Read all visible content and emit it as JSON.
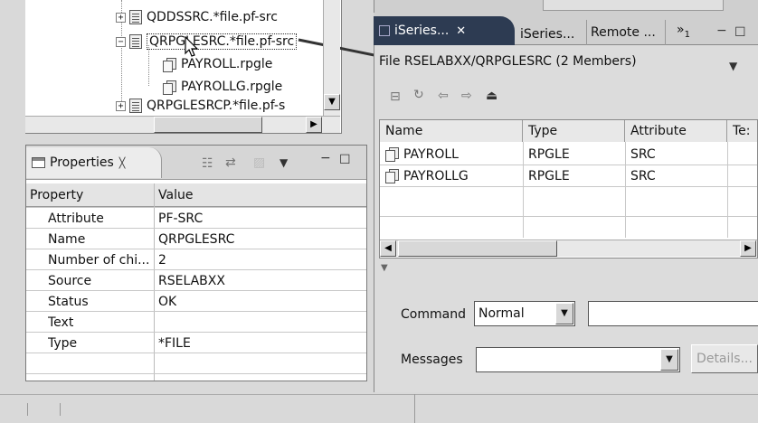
{
  "tree": {
    "items": [
      {
        "label": "QDDSSRC.*file.pf-src",
        "expander": "+"
      },
      {
        "label": "QRPGLESRC.*file.pf-src",
        "expander": "−"
      },
      {
        "label": "PAYROLL.rpgle"
      },
      {
        "label": "PAYROLLG.rpgle"
      },
      {
        "label": "QRPGLESRCP.*file.pf-s",
        "expander": "+"
      }
    ]
  },
  "properties": {
    "tab_title": "Properties",
    "tab_close": "╳",
    "headers": {
      "property": "Property",
      "value": "Value"
    },
    "rows": [
      {
        "property": "Attribute",
        "value": "PF-SRC"
      },
      {
        "property": "Name",
        "value": "QRPGLESRC"
      },
      {
        "property": "Number of chi...",
        "value": "2"
      },
      {
        "property": "Source",
        "value": "RSELABXX"
      },
      {
        "property": "Status",
        "value": "OK"
      },
      {
        "property": "Text",
        "value": ""
      },
      {
        "property": "Type",
        "value": "*FILE"
      }
    ]
  },
  "iseries": {
    "tabs": [
      {
        "label": "iSeries...",
        "close": "✕",
        "active": true
      },
      {
        "label": "iSeries...",
        "active": false
      },
      {
        "label": "Remote ...",
        "active": false
      }
    ],
    "overflow": "»",
    "overflow_count": "1",
    "path": "File RSELABXX/QRPGLESRC (2 Members)",
    "columns": [
      "Name",
      "Type",
      "Attribute",
      "Te:"
    ],
    "rows": [
      {
        "name": "PAYROLL",
        "type": "RPGLE",
        "attribute": "SRC"
      },
      {
        "name": "PAYROLLG",
        "type": "RPGLE",
        "attribute": "SRC"
      }
    ],
    "command_label": "Command",
    "command_mode": "Normal",
    "command_value": "",
    "messages_label": "Messages",
    "messages_value": "",
    "details_button": "Details..."
  }
}
